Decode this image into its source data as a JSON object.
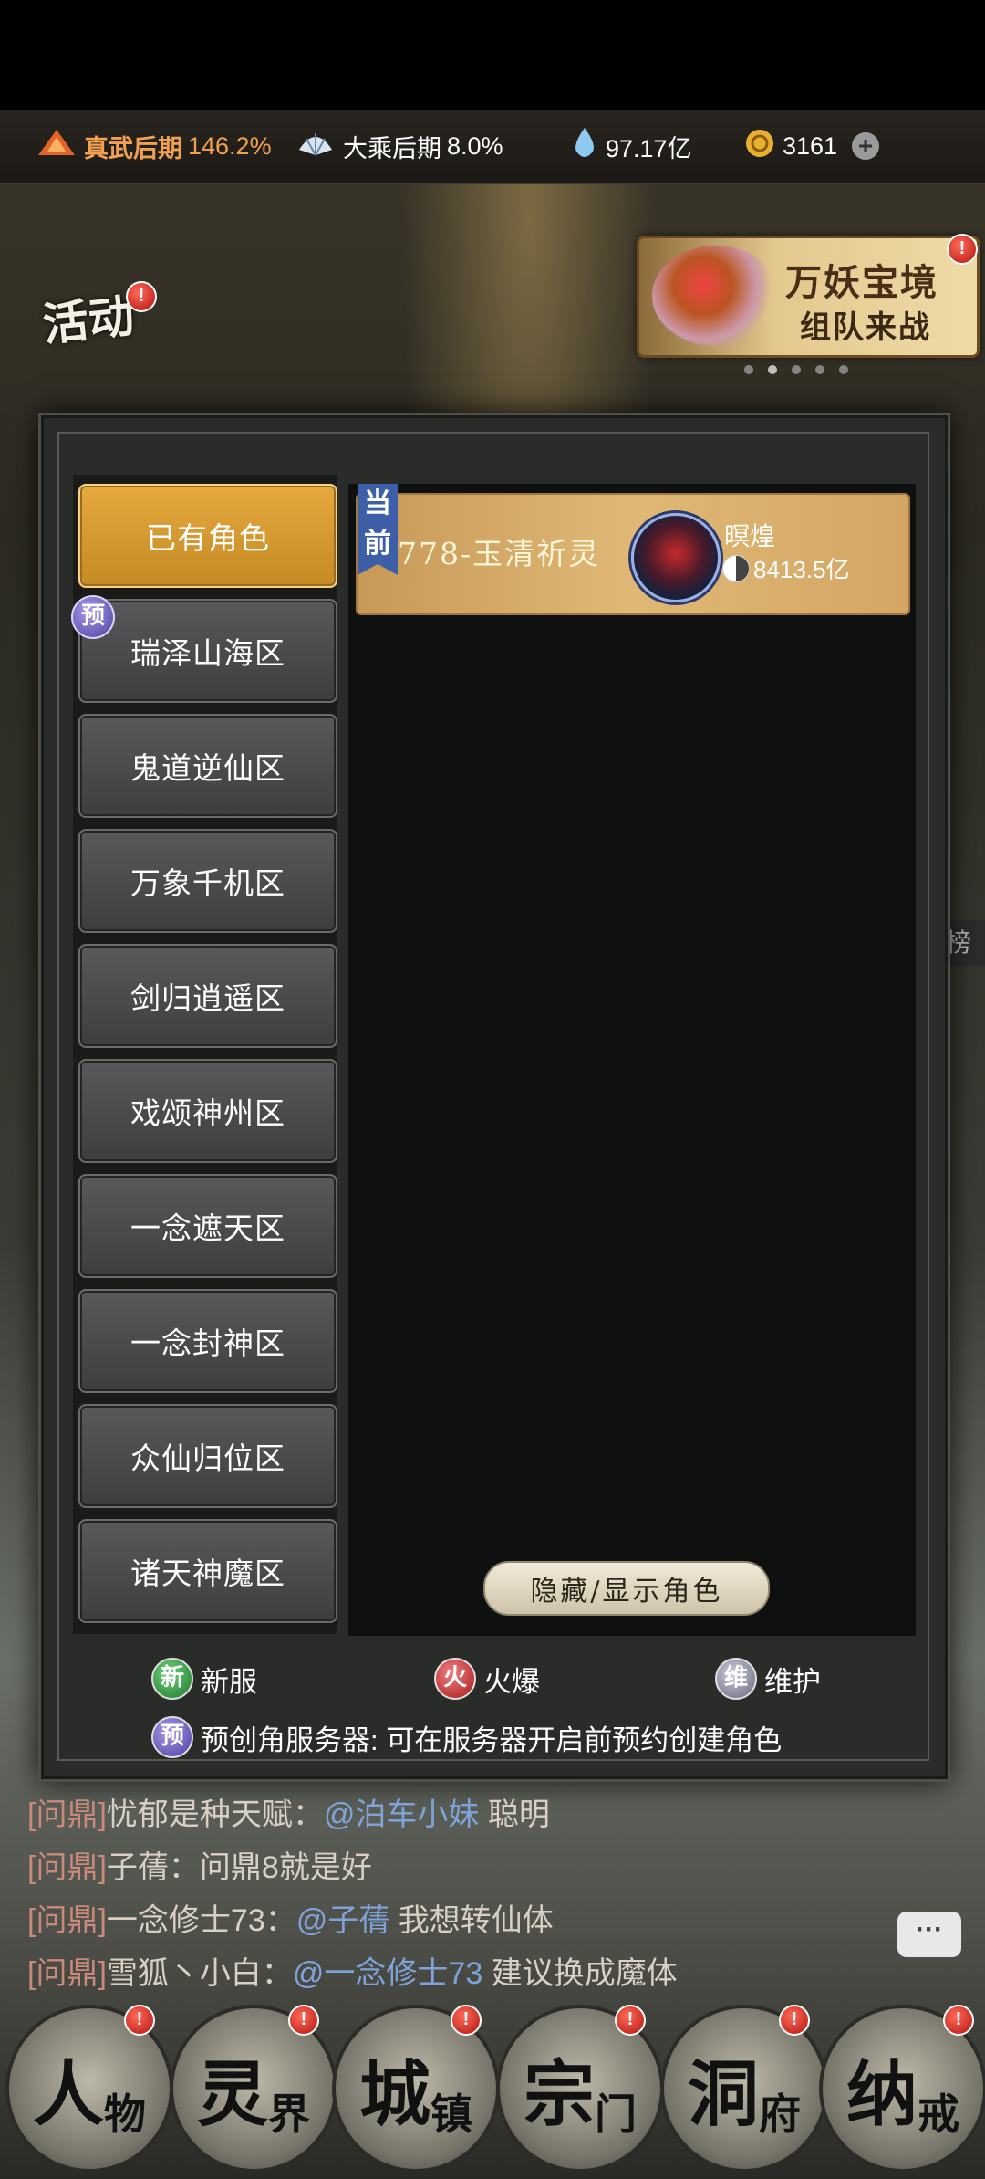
{
  "topbar": {
    "realm1": {
      "label": "真武后期",
      "percent": "146.2%"
    },
    "realm2": {
      "label": "大乘后期",
      "percent": "8.0%"
    },
    "spirit": {
      "value": "97.17亿"
    },
    "currency": {
      "value": "3161"
    }
  },
  "activity": {
    "label": "活动",
    "badge": "!"
  },
  "banner": {
    "title": "万妖宝境",
    "subtitle": "组队来战",
    "badge": "!"
  },
  "edge_tag": "榜",
  "sidebar": {
    "items": [
      {
        "label": "已有角色",
        "selected": true
      },
      {
        "label": "瑞泽山海区",
        "badge": "预"
      },
      {
        "label": "鬼道逆仙区"
      },
      {
        "label": "万象千机区"
      },
      {
        "label": "剑归逍遥区"
      },
      {
        "label": "戏颂神州区"
      },
      {
        "label": "一念遮天区"
      },
      {
        "label": "一念封神区"
      },
      {
        "label": "众仙归位区"
      },
      {
        "label": "诸天神魔区"
      }
    ]
  },
  "role_card": {
    "current_tag": "当前",
    "server_name": "778-玉清祈灵",
    "role_name": "暝煌",
    "power": "8413.5亿"
  },
  "toggle_button": "隐藏/显示角色",
  "legend": {
    "new": {
      "badge": "新",
      "label": "新服"
    },
    "hot": {
      "badge": "火",
      "label": "火爆"
    },
    "maint": {
      "badge": "维",
      "label": "维护"
    },
    "pre": {
      "badge": "预",
      "label": "预创角服务器: 可在服务器开启前预约创建角色"
    }
  },
  "chat": [
    {
      "channel": "[问鼎]",
      "sender": "忧郁是种天赋：",
      "mention": "@泊车小妹",
      "text": "聪明"
    },
    {
      "channel": "[问鼎]",
      "sender": "子蒨：",
      "mention": "",
      "text": "问鼎8就是好"
    },
    {
      "channel": "[问鼎]",
      "sender": "一念修士73：",
      "mention": "@子蒨",
      "text": "我想转仙体"
    },
    {
      "channel": "[问鼎]",
      "sender": "雪狐丶小白：",
      "mention": "@一念修士73",
      "text": "建议换成魔体"
    }
  ],
  "chat_button": "···",
  "bottom_nav": [
    {
      "big": "人",
      "small": "物"
    },
    {
      "big": "灵",
      "small": "界"
    },
    {
      "big": "城",
      "small": "镇"
    },
    {
      "big": "宗",
      "small": "门"
    },
    {
      "big": "洞",
      "small": "府"
    },
    {
      "big": "纳",
      "small": "戒"
    }
  ],
  "colors": {
    "accent_gold": "#e5a93f",
    "realm_text": "#f0a050",
    "mention_blue": "#7fa3d8",
    "badge_red": "#b3140d"
  }
}
